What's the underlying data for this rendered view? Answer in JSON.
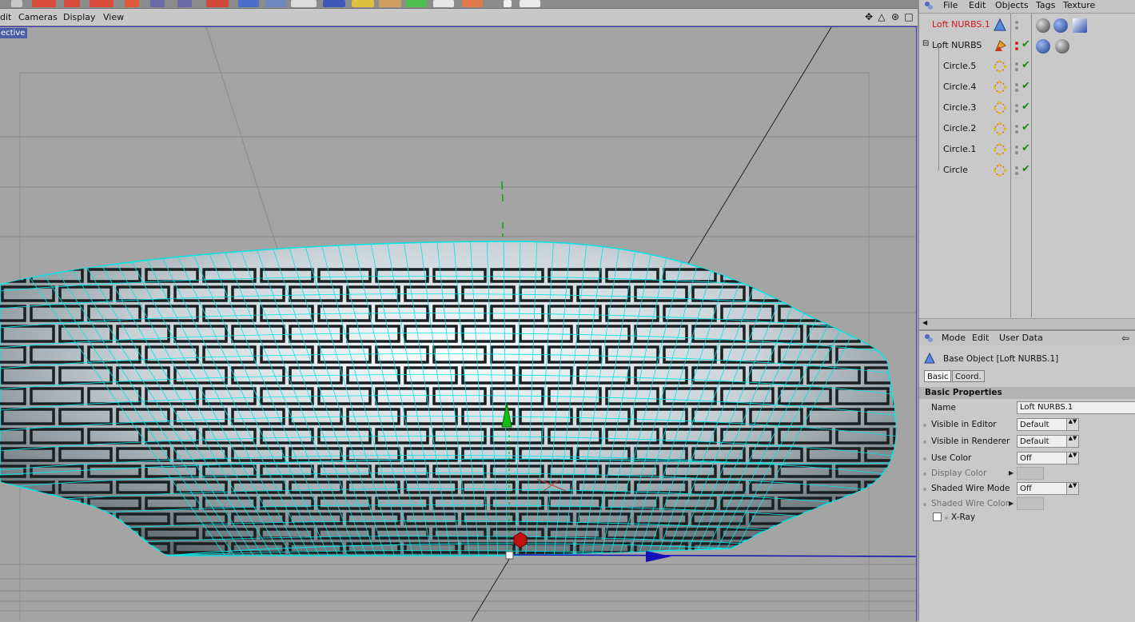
{
  "viewport": {
    "menu": [
      "dit",
      "Cameras",
      "Display",
      "View"
    ],
    "view_label": "ective",
    "controls": [
      "move-view",
      "rotate-view",
      "zoom-view",
      "maximize-view"
    ]
  },
  "object_manager": {
    "menu": [
      "File",
      "Edit",
      "Objects",
      "Tags",
      "Texture"
    ],
    "objects": [
      {
        "name": "Loft NURBS.1",
        "selected": true
      },
      {
        "name": "Loft NURBS",
        "selected": false
      },
      {
        "name": "Circle.5",
        "selected": false
      },
      {
        "name": "Circle.4",
        "selected": false
      },
      {
        "name": "Circle.3",
        "selected": false
      },
      {
        "name": "Circle.2",
        "selected": false
      },
      {
        "name": "Circle.1",
        "selected": false
      },
      {
        "name": "Circle",
        "selected": false
      }
    ],
    "expand_symbol": "⊟"
  },
  "attribute_manager": {
    "menu": [
      "Mode",
      "Edit",
      "User Data"
    ],
    "header": "Base Object [Loft NURBS.1]",
    "tabs": [
      "Basic",
      "Coord."
    ],
    "section": "Basic Properties",
    "name_label": "Name",
    "name_value": "Loft NURBS.1",
    "fields": [
      {
        "label": "Visible in Editor",
        "value": "Default"
      },
      {
        "label": "Visible in Renderer",
        "value": "Default"
      },
      {
        "label": "Use Color",
        "value": "Off"
      },
      {
        "label": "Display Color",
        "value": ""
      },
      {
        "label": "Shaded Wire Mode",
        "value": "Off"
      },
      {
        "label": "Shaded Wire Color",
        "value": ""
      }
    ],
    "xray_label": "X-Ray"
  },
  "colors": {
    "selected_object": "#d4141e",
    "wire": "#00e6e6",
    "x_axis": "#1010b4",
    "y_axis": "#10a010",
    "check": "#1a8a1a"
  }
}
